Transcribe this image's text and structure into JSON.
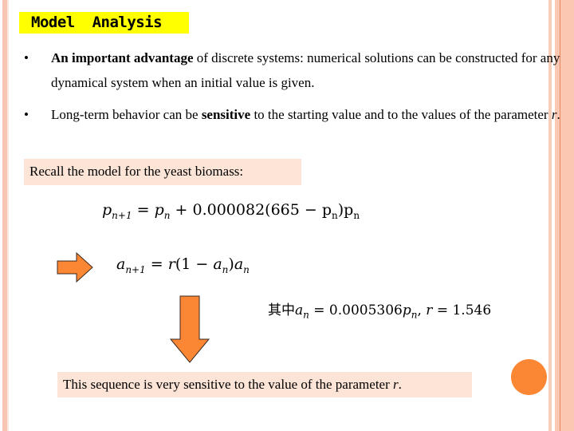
{
  "slide": {
    "title": "Model  Analysis",
    "bullets": [
      {
        "marker": "•",
        "bold_lead": "An important advantage",
        "rest": " of discrete systems: numerical solutions can be constructed for any dynamical system when an initial value is given."
      },
      {
        "marker": "•",
        "pre": "Long-term behavior can be ",
        "bold": "sensitive",
        "post": " to the starting value and to the values of the parameter ",
        "italic_end": "r",
        "end": "."
      }
    ],
    "recall_text": "Recall the model for the yeast biomass:",
    "equations": {
      "eq1": {
        "lhs_var": "p",
        "lhs_sub": "n+1",
        "equals": " = ",
        "term1_var": "p",
        "term1_sub": "n",
        "plus": " + 0.000082(665 − p",
        "inner_sub": "n",
        "close": ")p",
        "end_sub": "n"
      },
      "eq2": {
        "lhs_var": "a",
        "lhs_sub": "n+1",
        "rhs_pre": " = ",
        "r": "r",
        "mid": "(1 − ",
        "a1": "a",
        "a1_sub": "n",
        "close": ")",
        "a2": "a",
        "a2_sub": "n"
      },
      "eq3": {
        "prefix": "其中",
        "a": "a",
        "a_sub": "n",
        "mid": " = 0.0005306",
        "p": "p",
        "p_sub": "n",
        "comma": ",  ",
        "r": "r",
        "tail": " = 1.546"
      }
    },
    "conclusion": {
      "pre": "This sequence is very sensitive to the value of the parameter ",
      "italic": "r",
      "end": "."
    },
    "icons": {
      "right_arrow": "right-arrow",
      "down_arrow": "down-arrow",
      "decor_circle": "orange-circle"
    },
    "colors": {
      "title_highlight": "#ffff00",
      "box_fill": "#fce4d6",
      "arrow_fill": "#fb8633",
      "arrow_stroke": "#3a2a20",
      "border_peach": "#f7c5b2"
    }
  }
}
